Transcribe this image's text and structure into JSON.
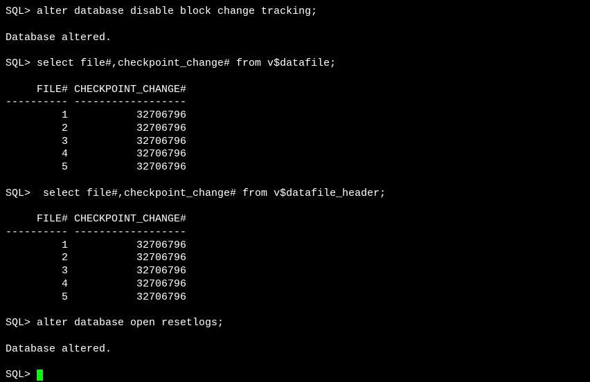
{
  "prompt": "SQL>",
  "commands": {
    "cmd1_text": "SQL> alter database disable block change tracking;",
    "cmd1_result": "Database altered.",
    "cmd2_text": "SQL> select file#,checkpoint_change# from v$datafile;",
    "cmd3_text": "SQL>  select file#,checkpoint_change# from v$datafile_header;",
    "cmd4_text": "SQL> alter database open resetlogs;",
    "cmd4_result": "Database altered.",
    "final_prompt": "SQL> "
  },
  "table1": {
    "header": "     FILE# CHECKPOINT_CHANGE#",
    "divider": "---------- ------------------",
    "rows": [
      "         1           32706796",
      "         2           32706796",
      "         3           32706796",
      "         4           32706796",
      "         5           32706796"
    ]
  },
  "table2": {
    "header": "     FILE# CHECKPOINT_CHANGE#",
    "divider": "---------- ------------------",
    "rows": [
      "         1           32706796",
      "         2           32706796",
      "         3           32706796",
      "         4           32706796",
      "         5           32706796"
    ]
  }
}
